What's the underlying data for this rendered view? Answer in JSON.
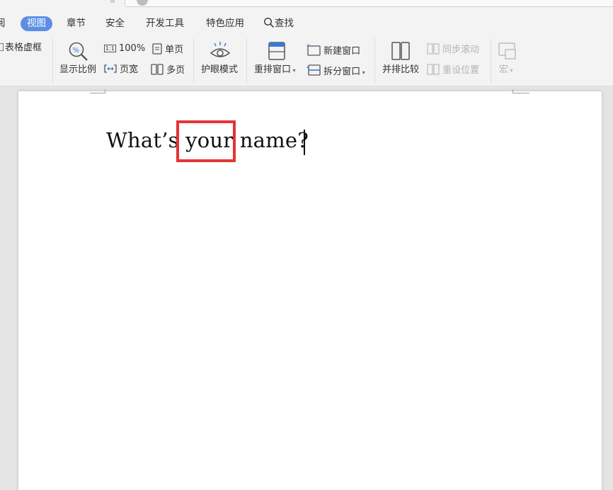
{
  "tabs": [
    {
      "label": "阅",
      "active": false
    },
    {
      "label": "视图",
      "active": true
    },
    {
      "label": "章节",
      "active": false
    },
    {
      "label": "安全",
      "active": false
    },
    {
      "label": "开发工具",
      "active": false
    },
    {
      "label": "特色应用",
      "active": false
    },
    {
      "label": "查找",
      "active": false
    }
  ],
  "ribbon": {
    "table_gridlines": "表格虚框",
    "zoom": "显示比例",
    "zoom_100": "100%",
    "page_width": "页宽",
    "single_page": "单页",
    "multi_page": "多页",
    "eye_protection": "护眼模式",
    "rearrange_window": "重排窗口",
    "new_window": "新建窗口",
    "split_window": "拆分窗口",
    "side_by_side": "并排比较",
    "sync_scroll": "同步滚动",
    "reset_position": "重设位置",
    "macro": "宏"
  },
  "icons": {
    "zoom": "zoom-percent-icon",
    "one_to_one": "one-to-one-icon",
    "page_width": "page-width-icon",
    "single_page": "single-page-icon",
    "multi_page": "multi-page-icon",
    "eye": "eye-icon",
    "rearrange": "rearrange-window-icon",
    "new_window": "new-window-icon",
    "split": "split-window-icon",
    "side_by_side": "side-by-side-icon",
    "sync_scroll": "sync-scroll-icon",
    "reset_position": "reset-position-icon",
    "macro": "macro-icon",
    "search": "search-icon"
  },
  "document": {
    "before": "What’s ",
    "highlight": "your",
    "after": " name?"
  },
  "colors": {
    "active_tab": "#5b8fe6",
    "highlight_box": "#e33535",
    "icon_blue": "#3b78d8"
  }
}
